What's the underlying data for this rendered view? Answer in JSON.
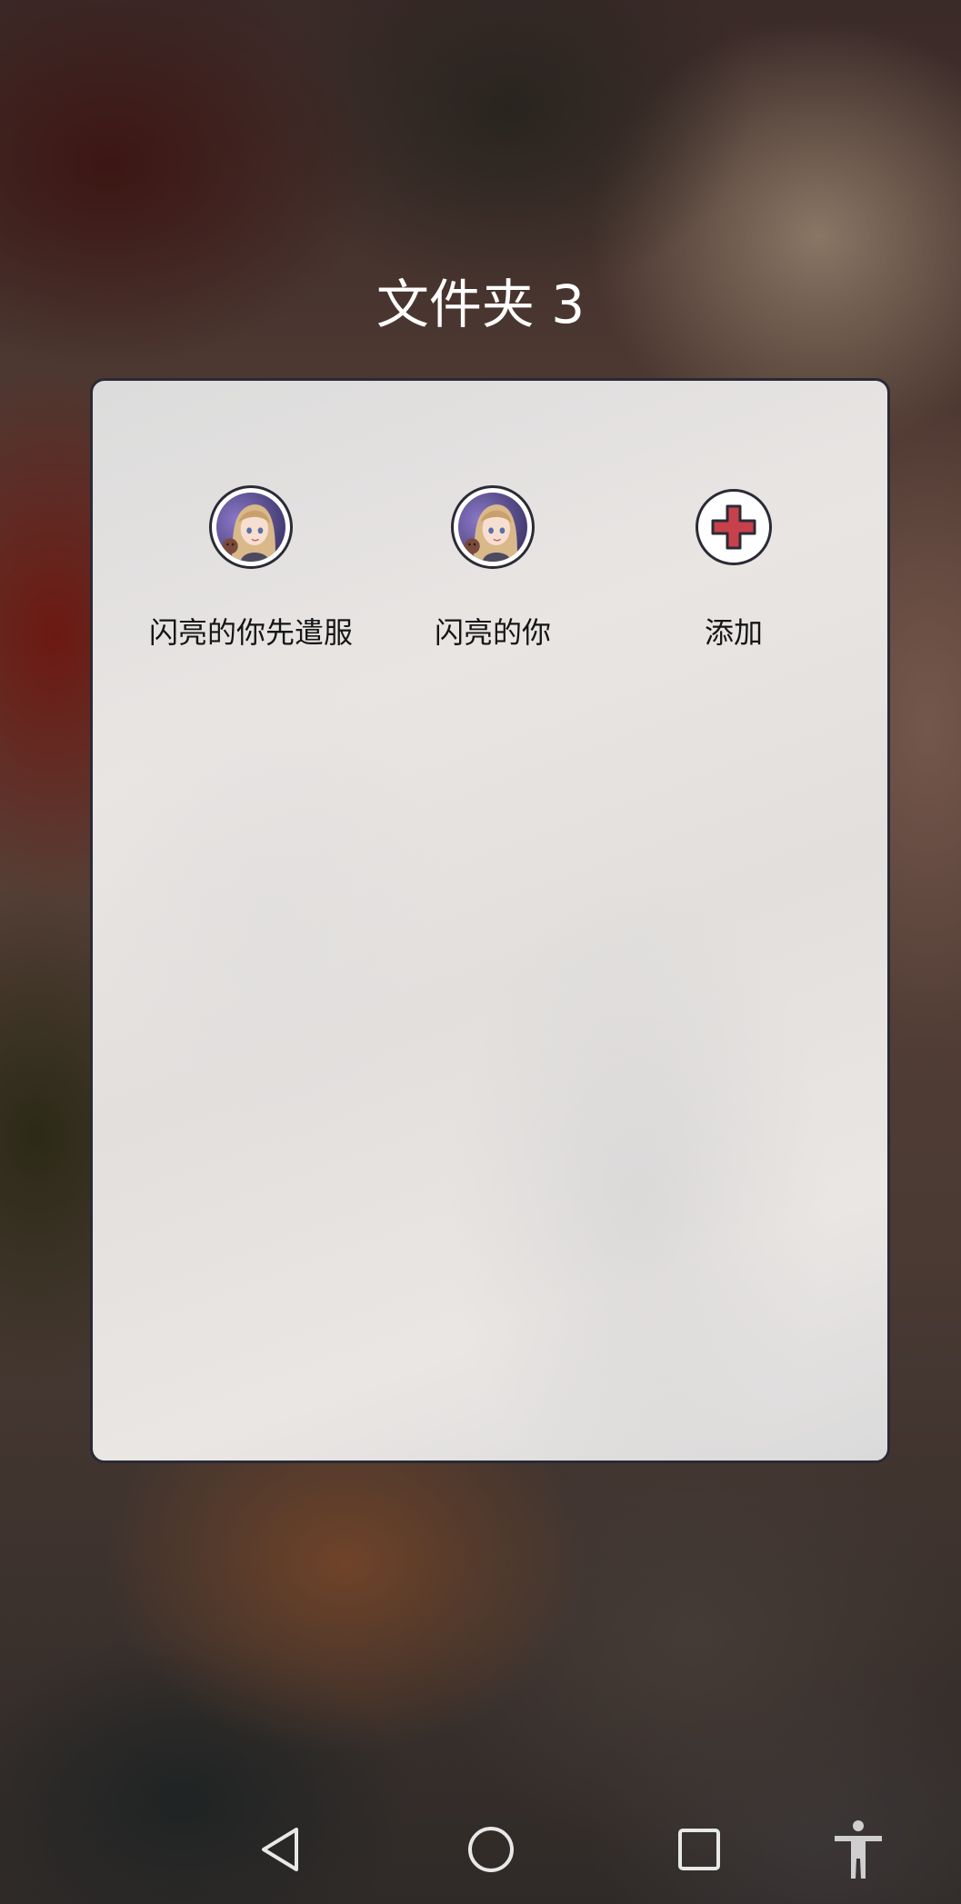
{
  "folder": {
    "title": "文件夹 3"
  },
  "apps": [
    {
      "label": "闪亮的你先遣服",
      "icon": "game-avatar-icon"
    },
    {
      "label": "闪亮的你",
      "icon": "game-avatar-icon"
    },
    {
      "label": "添加",
      "icon": "add-plus-icon"
    }
  ],
  "navbar": {
    "back": "back-triangle-icon",
    "home": "home-circle-icon",
    "recents": "recents-square-icon",
    "accessibility": "accessibility-person-icon"
  },
  "colors": {
    "add_plus": "#c7414b",
    "outline": "#2b2b36",
    "title_text": "#ffffff"
  }
}
